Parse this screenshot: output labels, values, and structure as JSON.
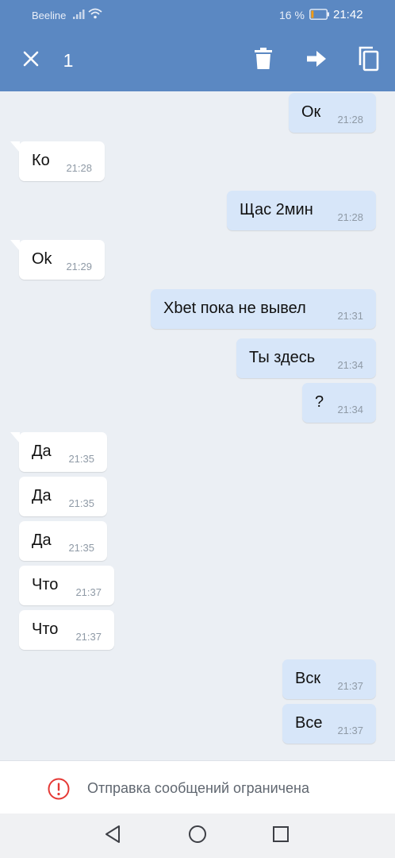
{
  "status_bar": {
    "carrier": "Beeline",
    "battery_percent": "16 %",
    "time": "21:42",
    "battery_level": 0.16,
    "battery_color": "#f39c12"
  },
  "action_bar": {
    "selected_count": "1",
    "icons": [
      "close-icon",
      "trash-icon",
      "forward-icon",
      "copy-icon"
    ],
    "color": "#5b88c2"
  },
  "messages": [
    {
      "dir": "out",
      "text": "Ок",
      "time": "21:28"
    },
    {
      "dir": "in",
      "text": "Ко",
      "time": "21:28"
    },
    {
      "dir": "out",
      "text": "Щас 2мин",
      "time": "21:28"
    },
    {
      "dir": "in",
      "text": "Ok",
      "time": "21:29"
    },
    {
      "dir": "out",
      "text": "Xbet пока не вывел",
      "time": "21:31"
    },
    {
      "dir": "out",
      "text": "Ты здесь",
      "time": "21:34"
    },
    {
      "dir": "out",
      "text": "?",
      "time": "21:34"
    },
    {
      "dir": "in",
      "text": "Да",
      "time": "21:35"
    },
    {
      "dir": "in",
      "text": "Да",
      "time": "21:35"
    },
    {
      "dir": "in",
      "text": "Да",
      "time": "21:35"
    },
    {
      "dir": "in",
      "text": "Что",
      "time": "21:37"
    },
    {
      "dir": "in",
      "text": "Что",
      "time": "21:37"
    },
    {
      "dir": "out",
      "text": "Вск",
      "time": "21:37"
    },
    {
      "dir": "out",
      "text": "Все",
      "time": "21:37"
    }
  ],
  "restricted_banner": {
    "text": "Отправка сообщений ограничена",
    "icon": "alert-circle-icon",
    "icon_color": "#e53935"
  },
  "navigation_bar": {
    "icons": [
      "back-icon",
      "home-icon",
      "recent-apps-icon"
    ]
  }
}
